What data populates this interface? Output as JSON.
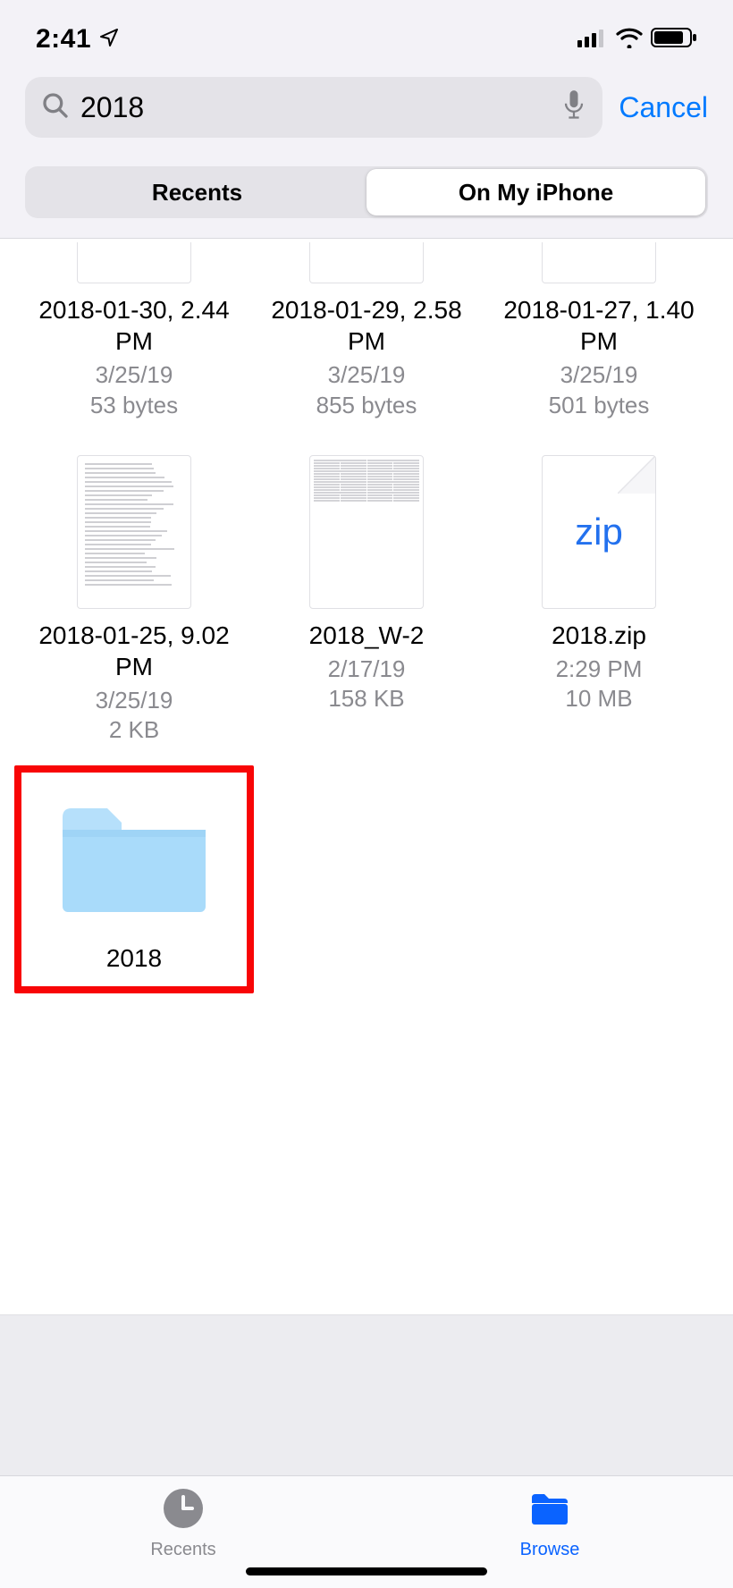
{
  "status": {
    "time": "2:41"
  },
  "search": {
    "query": "2018",
    "cancel": "Cancel"
  },
  "segments": {
    "recents": "Recents",
    "on_my_iphone": "On My iPhone"
  },
  "items": [
    {
      "name": "2018-01-30, 2.44 PM",
      "date": "3/25/19",
      "size": "53 bytes",
      "type": "doc",
      "partial": true
    },
    {
      "name": "2018-01-29, 2.58 PM",
      "date": "3/25/19",
      "size": "855 bytes",
      "type": "doc",
      "partial": true
    },
    {
      "name": "2018-01-27, 1.40 PM",
      "date": "3/25/19",
      "size": "501 bytes",
      "type": "doc",
      "partial": true
    },
    {
      "name": "2018-01-25, 9.02 PM",
      "date": "3/25/19",
      "size": "2 KB",
      "type": "doc"
    },
    {
      "name": "2018_W-2",
      "date": "2/17/19",
      "size": "158 KB",
      "type": "form"
    },
    {
      "name": "2018.zip",
      "date": "2:29 PM",
      "size": "10 MB",
      "type": "zip",
      "ziptext": "zip"
    },
    {
      "name": "2018",
      "type": "folder",
      "highlighted": true
    }
  ],
  "tabs": {
    "recents": "Recents",
    "browse": "Browse"
  }
}
